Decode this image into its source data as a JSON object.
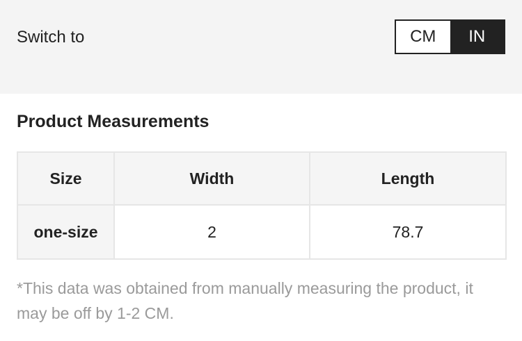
{
  "switch": {
    "label": "Switch to",
    "options": [
      "CM",
      "IN"
    ],
    "selected": "IN"
  },
  "section": {
    "title": "Product Measurements"
  },
  "table": {
    "headers": [
      "Size",
      "Width",
      "Length"
    ],
    "rows": [
      [
        "one-size",
        "2",
        "78.7"
      ]
    ]
  },
  "note": "*This data was obtained from manually measuring the product, it may be off by 1-2 CM.",
  "colors": {
    "active_bg": "#222222",
    "bar_bg": "#f4f4f4",
    "note_text": "#9a9a9a"
  }
}
